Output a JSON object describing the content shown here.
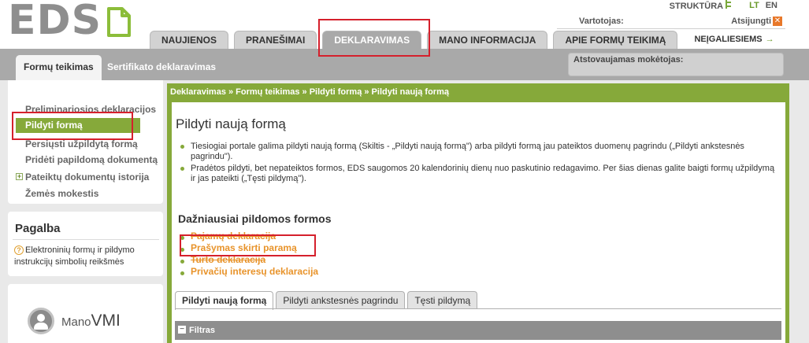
{
  "header": {
    "logo_text": "EDS",
    "top_links": {
      "structure": "STRUKTŪRA",
      "lang_lt": "LT",
      "lang_en": "EN"
    },
    "user_label": "Vartotojas:",
    "logout_label": "Atsijungti"
  },
  "main_tabs": [
    {
      "label": "NAUJIENOS"
    },
    {
      "label": "PRANEŠIMAI"
    },
    {
      "label": "DEKLARAVIMAS"
    },
    {
      "label": "MANO INFORMACIJA"
    },
    {
      "label": "APIE FORMŲ TEIKIMĄ"
    },
    {
      "label": "NEĮGALIESIEMS"
    }
  ],
  "subnav": {
    "active": "Formų teikimas",
    "other": "Sertifikato deklaravimas",
    "payer_label": "Atstovaujamas mokėtojas:"
  },
  "sidebar": {
    "items": [
      {
        "label": "Preliminariosios deklaracijos"
      },
      {
        "label": "Pildyti formą"
      },
      {
        "label": "Persiųsti užpildytą formą"
      },
      {
        "label": "Pridėti papildomą dokumentą"
      },
      {
        "label": "Pateiktų dokumentų istorija"
      },
      {
        "label": "Žemės mokestis"
      }
    ]
  },
  "help": {
    "title": "Pagalba",
    "text": "Elektroninių formų ir pildymo instrukcijų simbolių reikšmės"
  },
  "manovmi": {
    "prefix": "Mano",
    "brand": "VMI"
  },
  "main": {
    "breadcrumb": "Deklaravimas » Formų teikimas » Pildyti formą » Pildyti naują formą",
    "title": "Pildyti naują formą",
    "bullets": [
      "Tiesiogiai portale galima pildyti naują formą (Skiltis - „Pildyti naują formą\") arba pildyti formą jau pateiktos duomenų pagrindu („Pildyti ankstesnės pagrindu\").",
      "Pradėtos pildyti, bet nepateiktos formos, EDS saugomos 20 kalendorinių dienų nuo paskutinio redagavimo. Per šias dienas galite baigti formų užpildymą ir jas pateikti („Tęsti pildymą\")."
    ],
    "section_title": "Dažniausiai pildomos formos",
    "forms": [
      {
        "label": "Pajamų deklaracija"
      },
      {
        "label": "Prašymas skirti paramą"
      },
      {
        "label": "Turto deklaracija"
      },
      {
        "label": "Privačių interesų deklaracija"
      }
    ],
    "content_tabs": [
      {
        "label": "Pildyti naują formą"
      },
      {
        "label": "Pildyti ankstesnės pagrindu"
      },
      {
        "label": "Tęsti pildymą"
      }
    ],
    "filter_label": "Filtras"
  },
  "colors": {
    "accent_green": "#86a93a",
    "link_orange": "#e8932a",
    "highlight_red": "#d5202c"
  }
}
